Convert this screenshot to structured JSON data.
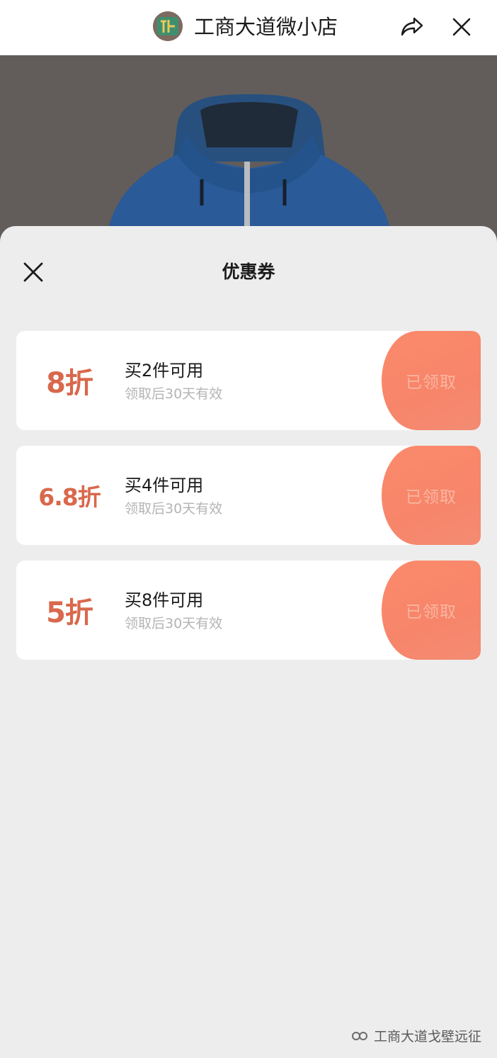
{
  "header": {
    "shop_name": "工商大道微小店",
    "logo_icon": "shop-logo",
    "share_icon": "share-icon",
    "close_icon": "close-icon"
  },
  "sheet": {
    "title": "优惠券",
    "close_icon": "close-icon"
  },
  "coupons": [
    {
      "discount": "8折",
      "condition": "买2件可用",
      "validity": "领取后30天有效",
      "status": "已领取"
    },
    {
      "discount": "6.8折",
      "condition": "买4件可用",
      "validity": "领取后30天有效",
      "status": "已领取"
    },
    {
      "discount": "5折",
      "condition": "买8件可用",
      "validity": "领取后30天有效",
      "status": "已领取"
    }
  ],
  "watermark": {
    "text": "工商大道戈壁远征",
    "icon": "wechat-channel-icon"
  },
  "colors": {
    "discount": "#d9684c",
    "claim_button": "#f7856a",
    "background": "#ededed"
  }
}
